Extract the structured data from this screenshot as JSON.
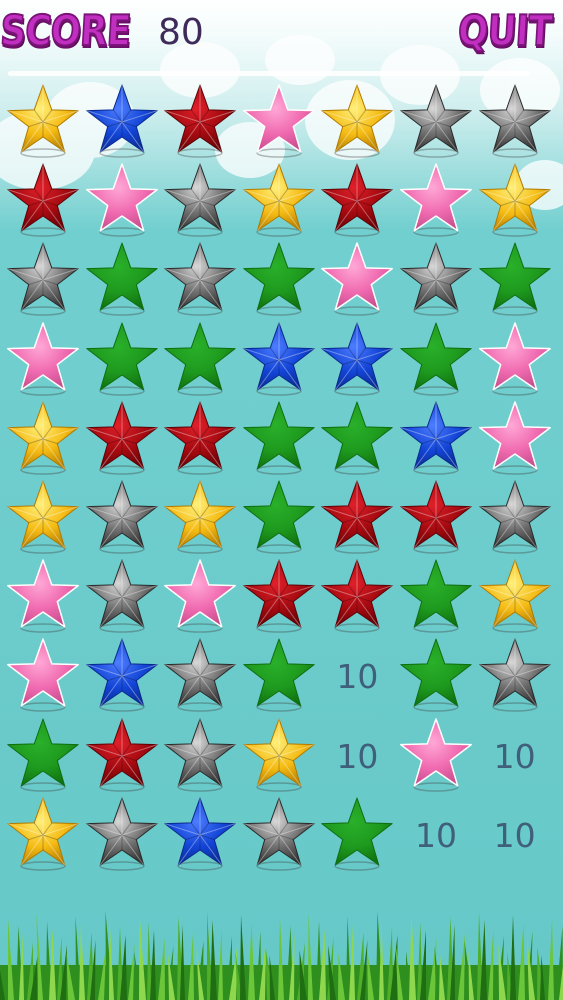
{
  "hud": {
    "score_label": "SCORE",
    "score_value": "80",
    "quit_label": "QUIT"
  },
  "colors": {
    "yellow": [
      "#fff07a",
      "#f5bb14",
      "#b07a00"
    ],
    "blue": [
      "#4d7dff",
      "#1244d6",
      "#0a2a8c"
    ],
    "red": [
      "#e0202a",
      "#a40a10",
      "#5e0206"
    ],
    "pink": [
      "#ffa8d6",
      "#f06ab0",
      "#c24a8a"
    ],
    "gray": [
      "#d8d8d8",
      "#6e6e6e",
      "#2a2a2a"
    ],
    "green": [
      "#2ab02a",
      "#1e9a1e",
      "#0f6e0f"
    ]
  },
  "board": {
    "rows": [
      [
        "yellow",
        "blue",
        "red",
        "pink",
        "yellow",
        "gray",
        "gray"
      ],
      [
        "red",
        "pink",
        "gray",
        "yellow",
        "red",
        "pink",
        "yellow"
      ],
      [
        "gray",
        "green",
        "gray",
        "green",
        "pink",
        "gray",
        "green"
      ],
      [
        "pink",
        "green",
        "green",
        "blue",
        "blue",
        "green",
        "pink"
      ],
      [
        "yellow",
        "red",
        "red",
        "green",
        "green",
        "blue",
        "pink"
      ],
      [
        "yellow",
        "gray",
        "yellow",
        "green",
        "red",
        "red",
        "gray"
      ],
      [
        "pink",
        "gray",
        "pink",
        "red",
        "red",
        "green",
        "yellow"
      ],
      [
        "pink",
        "blue",
        "gray",
        "green",
        "10",
        "green",
        "gray"
      ],
      [
        "green",
        "red",
        "gray",
        "yellow",
        "10",
        "pink",
        "10"
      ],
      [
        "yellow",
        "gray",
        "blue",
        "gray",
        "green",
        "10",
        "10"
      ]
    ]
  }
}
